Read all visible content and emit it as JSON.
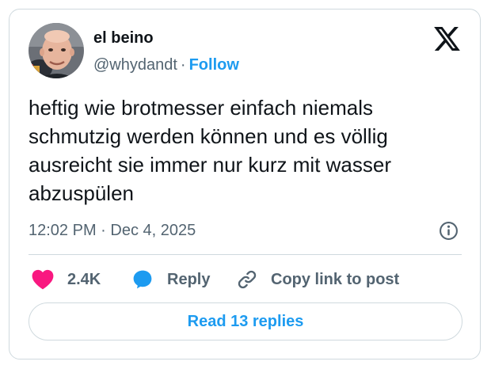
{
  "author": {
    "name": "el beino",
    "handle": "@whydandt",
    "separator": "·",
    "follow_label": "Follow"
  },
  "tweet": {
    "text": "heftig wie brotmesser einfach niemals schmutzig werden können und es völlig ausreicht sie immer nur kurz mit wasser abzuspülen",
    "timestamp": "12:02 PM · Dec 4, 2025"
  },
  "actions": {
    "like_count": "2.4K",
    "reply_label": "Reply",
    "copy_link_label": "Copy link to post"
  },
  "read_replies_label": "Read 13 replies",
  "icons": {
    "brand": "x-logo-icon",
    "info": "info-icon",
    "like": "heart-icon",
    "reply": "speech-bubble-icon",
    "copy": "link-icon"
  },
  "colors": {
    "accent": "#1d9bf0",
    "heart": "#f91880",
    "text_primary": "#0f1419",
    "text_secondary": "#536471",
    "border": "#cfd9de"
  }
}
